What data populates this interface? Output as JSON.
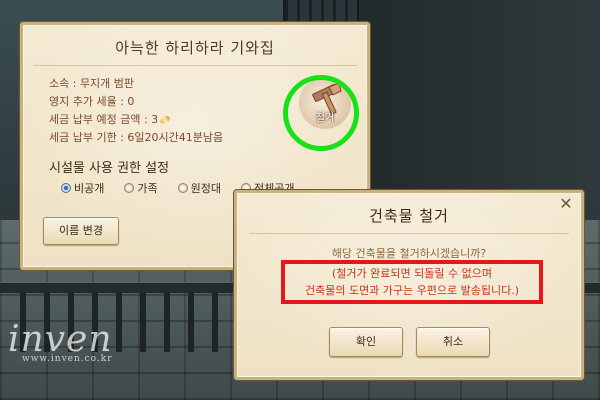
{
  "house_panel": {
    "title": "아늑한 하리하라 기와집",
    "info": {
      "affiliation": "소속 : 무지개 범판",
      "extra_tax": "영지 추가 세율 : 0",
      "expected_tax_prefix": "세금 납부 예정 금액 : 3",
      "tax_deadline": "세금 납부 기한 : 6일20시간41분남음"
    },
    "permissions": {
      "title": "시설물 사용 권한 설정",
      "options": [
        {
          "label": "비공개",
          "selected": true
        },
        {
          "label": "가족",
          "selected": false
        },
        {
          "label": "원정대",
          "selected": false
        },
        {
          "label": "전체공개",
          "selected": false
        }
      ]
    },
    "rename_button": "이름 변경",
    "demolish_label": "철거"
  },
  "dialog": {
    "title": "건축물 철거",
    "close": "✕",
    "question": "해당 건축물을 철거하시겠습니까?",
    "warning_line1": "(철거가 완료되면 되돌릴 수 없으며",
    "warning_line2": "건축물의 도면과 가구는 우편으로 발송됩니다.)",
    "confirm": "확인",
    "cancel": "취소"
  },
  "watermark": {
    "brand": "inven",
    "url": "www.inven.co.kr"
  },
  "colors": {
    "highlight_ring": "#17e117",
    "warning_border": "#e8161a"
  }
}
